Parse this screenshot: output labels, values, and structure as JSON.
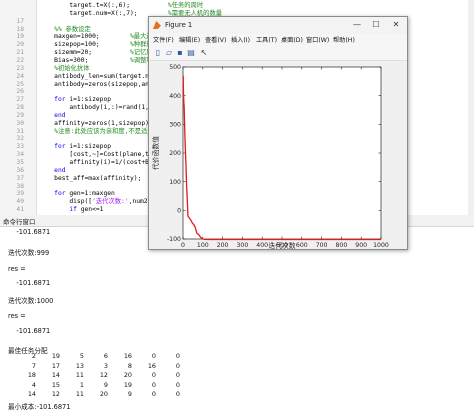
{
  "editor": {
    "lines": [
      {
        "n": "",
        "parts": [
          {
            "t": "        target.t=X(:,6);          ",
            "c": "tx"
          },
          {
            "t": "%任务的周时",
            "c": "cm"
          }
        ]
      },
      {
        "n": "",
        "parts": [
          {
            "t": "        target.num=X(:,7);        ",
            "c": "tx"
          },
          {
            "t": "%需要无人机的数量",
            "c": "cm"
          }
        ]
      },
      {
        "n": "17",
        "parts": []
      },
      {
        "n": "18",
        "parts": [
          {
            "t": "    %% 参数设定",
            "c": "cm"
          }
        ]
      },
      {
        "n": "19",
        "parts": [
          {
            "t": "    maxgen=1000;        ",
            "c": "tx"
          },
          {
            "t": "%最大迭代次数",
            "c": "cm"
          }
        ]
      },
      {
        "n": "20",
        "parts": [
          {
            "t": "    sizepop=100;        ",
            "c": "tx"
          },
          {
            "t": "%种群规模",
            "c": "cm"
          }
        ]
      },
      {
        "n": "21",
        "parts": [
          {
            "t": "    sizemm=20;          ",
            "c": "tx"
          },
          {
            "t": "%记忆库容量",
            "c": "cm"
          }
        ]
      },
      {
        "n": "22",
        "parts": [
          {
            "t": "    Bias=300;           ",
            "c": "tx"
          },
          {
            "t": "%调整项, 让适应度",
            "c": "cm"
          }
        ]
      },
      {
        "n": "23",
        "parts": [
          {
            "t": "    %初始化抗体",
            "c": "cm"
          }
        ]
      },
      {
        "n": "24",
        "parts": [
          {
            "t": "    antibody_len=sum(target.num(:));",
            "c": "tx"
          }
        ]
      },
      {
        "n": "25",
        "parts": [
          {
            "t": "    antibody=zeros(sizepop,antibody_l",
            "c": "tx"
          }
        ]
      },
      {
        "n": "26",
        "parts": []
      },
      {
        "n": "27",
        "parts": [
          {
            "t": "    ",
            "c": "tx"
          },
          {
            "t": "for",
            "c": "kw"
          },
          {
            "t": " i=1:sizepop",
            "c": "tx"
          }
        ]
      },
      {
        "n": "28",
        "parts": [
          {
            "t": "        antibody(i,:)=rand(1,antibody",
            "c": "tx"
          }
        ]
      },
      {
        "n": "29",
        "parts": [
          {
            "t": "    ",
            "c": "tx"
          },
          {
            "t": "end",
            "c": "kw"
          }
        ]
      },
      {
        "n": "30",
        "parts": [
          {
            "t": "    affinity=zeros(1,sizepop);",
            "c": "tx"
          }
        ]
      },
      {
        "n": "31",
        "parts": [
          {
            "t": "    %注意:此处应该为亲和度,不是适应度",
            "c": "cm"
          }
        ]
      },
      {
        "n": "32",
        "parts": []
      },
      {
        "n": "33",
        "parts": [
          {
            "t": "    ",
            "c": "tx"
          },
          {
            "t": "for",
            "c": "kw"
          },
          {
            "t": " i=1:sizepop",
            "c": "tx"
          }
        ]
      },
      {
        "n": "34",
        "parts": [
          {
            "t": "        [cost,~]=Cost(plane,target,an",
            "c": "tx"
          }
        ]
      },
      {
        "n": "35",
        "parts": [
          {
            "t": "        affinity(i)=1/(cost+Bias);",
            "c": "tx"
          }
        ]
      },
      {
        "n": "36",
        "parts": [
          {
            "t": "    ",
            "c": "tx"
          },
          {
            "t": "end",
            "c": "kw"
          }
        ]
      },
      {
        "n": "37",
        "parts": [
          {
            "t": "    best_aff=max(affinity);",
            "c": "tx"
          }
        ]
      },
      {
        "n": "38",
        "parts": []
      },
      {
        "n": "39",
        "parts": [
          {
            "t": "    ",
            "c": "tx"
          },
          {
            "t": "for",
            "c": "kw"
          },
          {
            "t": " gen=1:maxgen",
            "c": "tx"
          }
        ]
      },
      {
        "n": "40",
        "parts": [
          {
            "t": "        disp([",
            "c": "tx"
          },
          {
            "t": "'迭代次数:'",
            "c": "st"
          },
          {
            "t": ",num2str(gen",
            "c": "tx"
          }
        ]
      },
      {
        "n": "41",
        "parts": [
          {
            "t": "        ",
            "c": "tx"
          },
          {
            "t": "if",
            "c": "kw"
          },
          {
            "t": " gen<=1",
            "c": "tx"
          }
        ]
      }
    ]
  },
  "command_window": {
    "title": "命令行窗口",
    "lines": [
      {
        "text": "    -101.6871",
        "y": 232
      },
      {
        "text": "迭代次数:999",
        "y": 251
      },
      {
        "text": "res =",
        "y": 269
      },
      {
        "text": "    -101.6871",
        "y": 283
      },
      {
        "text": "迭代次数:1000",
        "y": 299
      },
      {
        "text": "res =",
        "y": 316
      },
      {
        "text": "    -101.6871",
        "y": 331
      },
      {
        "text": "最佳任务分配",
        "y": 349
      },
      {
        "text": "最小成本:-101.6871",
        "y": 405
      }
    ],
    "matrix": [
      [
        "2",
        "19",
        "5",
        "6",
        "16",
        "0",
        "0"
      ],
      [
        "7",
        "17",
        "13",
        "3",
        "8",
        "16",
        "0"
      ],
      [
        "18",
        "14",
        "11",
        "12",
        "20",
        "0",
        "0"
      ],
      [
        "4",
        "15",
        "1",
        "9",
        "19",
        "0",
        "0"
      ],
      [
        "14",
        "12",
        "11",
        "20",
        "9",
        "0",
        "0"
      ]
    ]
  },
  "figure": {
    "title": "Figure 1",
    "menu": [
      "文件(F)",
      "编辑(E)",
      "查看(V)",
      "插入(I)",
      "工具(T)",
      "桌面(D)",
      "窗口(W)",
      "帮助(H)"
    ],
    "toolbar_icons": [
      "new-figure-icon",
      "open-icon",
      "save-icon",
      "print-icon",
      "pointer-icon"
    ],
    "window_buttons": {
      "minimize": "—",
      "maximize": "☐",
      "close": "✕"
    }
  },
  "chart_data": {
    "type": "line",
    "xlabel": "迭代次数",
    "ylabel": "代价函数值",
    "xlim": [
      0,
      1000
    ],
    "ylim": [
      -100,
      500
    ],
    "xticks": [
      0,
      100,
      200,
      300,
      400,
      500,
      600,
      700,
      800,
      900,
      1000
    ],
    "yticks": [
      -100,
      0,
      100,
      200,
      300,
      400,
      500
    ],
    "series": [
      {
        "color": "#e41a1c",
        "x": [
          1,
          2,
          4,
          6,
          8,
          10,
          12,
          15,
          18,
          22,
          25,
          30,
          35,
          40,
          48,
          55,
          62,
          70,
          80,
          90,
          100,
          110,
          130,
          160,
          200,
          300,
          500,
          700,
          1000
        ],
        "y": [
          470,
          420,
          380,
          360,
          300,
          250,
          210,
          160,
          90,
          30,
          -20,
          -25,
          -30,
          -35,
          -45,
          -50,
          -60,
          -80,
          -85,
          -95,
          -100,
          -101,
          -101.5,
          -101.6871,
          -101.6871,
          -101.6871,
          -101.6871,
          -101.6871,
          -101.6871
        ]
      }
    ],
    "grid": false
  }
}
